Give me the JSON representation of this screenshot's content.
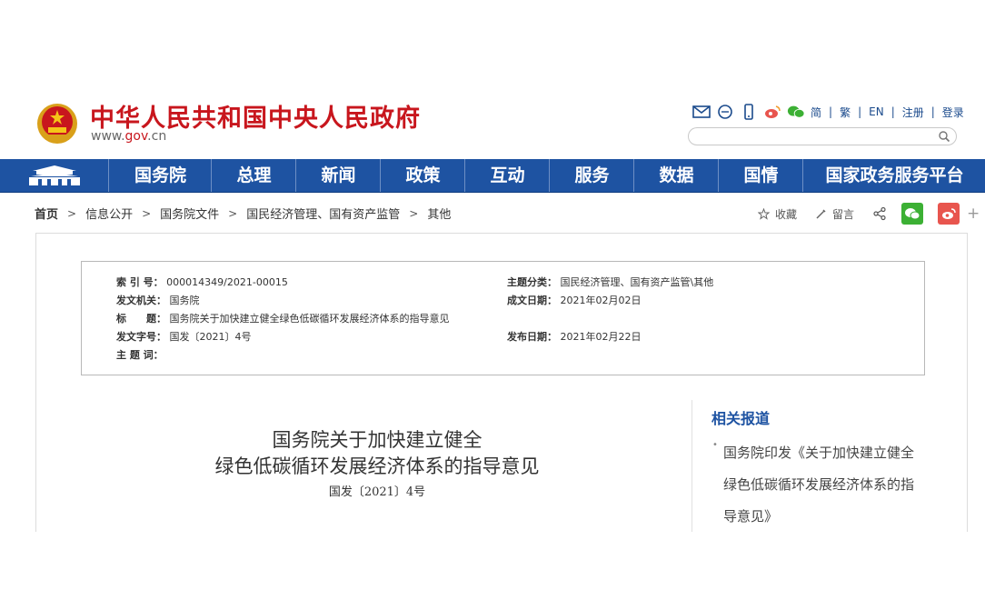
{
  "header": {
    "site_title": "中华人民共和国中央人民政府",
    "url_prefix": "www.",
    "url_gov": "gov",
    "url_suffix": ".cn",
    "tools": {
      "links": [
        "简",
        "繁",
        "EN",
        "注册",
        "登录"
      ]
    },
    "search_placeholder": ""
  },
  "nav": {
    "items": [
      "国务院",
      "总理",
      "新闻",
      "政策",
      "互动",
      "服务",
      "数据",
      "国情",
      "国家政务服务平台"
    ]
  },
  "breadcrumb": {
    "items": [
      "首页",
      "信息公开",
      "国务院文件",
      "国民经济管理、国有资产监管",
      "其他"
    ]
  },
  "share": {
    "collect": "收藏",
    "comment": "留言",
    "plus": "+"
  },
  "meta": {
    "index_label": "索 引 号：",
    "index_value": "000014349/2021-00015",
    "category_label": "主题分类：",
    "category_value": "国民经济管理、国有资产监管\\其他",
    "issuer_label": "发文机关：",
    "issuer_value": "国务院",
    "written_label": "成文日期：",
    "written_value": "2021年02月02日",
    "title_label": "标　　题：",
    "title_value": "国务院关于加快建立健全绿色低碳循环发展经济体系的指导意见",
    "docno_label": "发文字号：",
    "docno_value": "国发〔2021〕4号",
    "published_label": "发布日期：",
    "published_value": "2021年02月22日",
    "keywords_label": "主 题 词：",
    "keywords_value": ""
  },
  "document": {
    "title_line1": "国务院关于加快建立健全",
    "title_line2": "绿色低碳循环发展经济体系的指导意见",
    "doc_number": "国发〔2021〕4号"
  },
  "sidebar": {
    "heading": "相关报道",
    "bullet": "•",
    "link": "国务院印发《关于加快建立健全绿色低碳循环发展经济体系的指导意见》"
  },
  "colors": {
    "brand_red": "#c8161d",
    "nav_blue": "#1e53a2",
    "wechat_green": "#3cb034",
    "weibo_red": "#e8554e"
  },
  "icons": [
    "national-emblem-icon",
    "mail-icon",
    "chat-icon",
    "mobile-icon",
    "weibo-icon",
    "wechat-icon",
    "search-icon",
    "tiananmen-icon",
    "star-icon",
    "pen-icon",
    "share-icon"
  ]
}
